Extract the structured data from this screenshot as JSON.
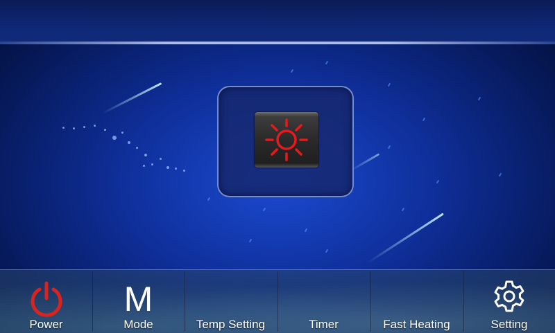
{
  "mode_display": {
    "current_mode_icon": "sun-icon",
    "icon_color": "#e8191b"
  },
  "toolbar": {
    "items": [
      {
        "label": "Power",
        "icon": "power-icon",
        "icon_color": "#d9231f"
      },
      {
        "label": "Mode",
        "icon": "mode-letter",
        "glyph": "M"
      },
      {
        "label": "Temp Setting"
      },
      {
        "label": "Timer"
      },
      {
        "label": "Fast Heating"
      },
      {
        "label": "Setting",
        "icon": "gear-icon"
      }
    ]
  }
}
